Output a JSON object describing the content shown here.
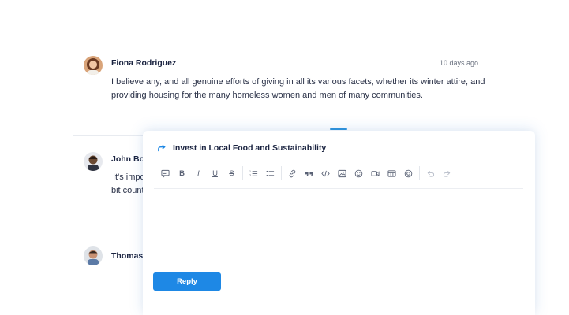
{
  "comments": [
    {
      "author": "Fiona Rodriguez",
      "time": "10 days ago",
      "text_line1": "I believe any, and all genuine efforts of giving in all its various facets, whether its winter attire, and",
      "text_line2": "providing housing for the many homeless women and men of many communities."
    },
    {
      "author": "John Bo",
      "text_line1": "It's impo",
      "text_line2": "bit count"
    },
    {
      "author": "Thomas"
    }
  ],
  "reply_panel": {
    "title": "Invest in Local Food and Sustainability",
    "toolbar": [
      "comment-icon",
      "bold-icon",
      "italic-icon",
      "underline-icon",
      "strikethrough-icon",
      "ordered-list-icon",
      "bullet-list-icon",
      "link-icon",
      "quote-icon",
      "code-icon",
      "image-icon",
      "emoji-icon",
      "video-icon",
      "table-icon",
      "settings-icon",
      "undo-icon",
      "redo-icon"
    ],
    "toolbar_labels": {
      "bold": "B",
      "italic": "I",
      "underline": "U",
      "strike": "S"
    },
    "reply_label": "Reply"
  },
  "colors": {
    "accent": "#1e88e5",
    "text": "#1a2340",
    "muted": "#6b7280"
  }
}
